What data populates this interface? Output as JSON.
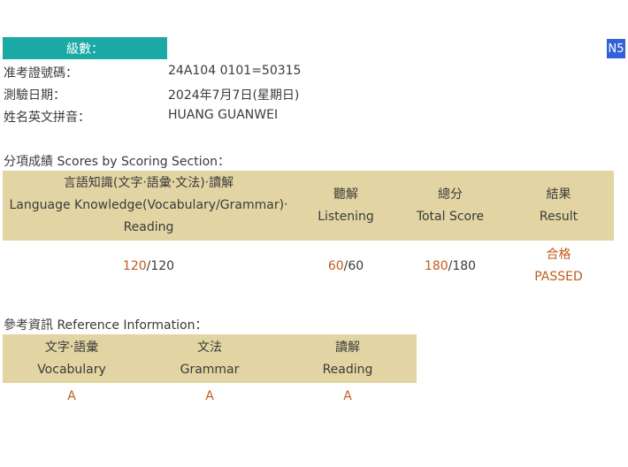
{
  "level": {
    "label": "級數：",
    "value": "N5"
  },
  "info": [
    {
      "label": "准考證號碼：",
      "value": "24A104 0101=50315"
    },
    {
      "label": "測驗日期：",
      "value": "2024年7月7日(星期日)"
    },
    {
      "label": "姓名英文拼音：",
      "value": "HUANG GUANWEI"
    }
  ],
  "scores": {
    "title": "分項成績 Scores by Scoring Section：",
    "headers": [
      {
        "zh": "言語知識(文字‧語彙‧文法)‧讀解",
        "en1": "Language Knowledge(Vocabulary/Grammar)‧",
        "en2": "Reading"
      },
      {
        "zh": "聽解",
        "en1": "Listening"
      },
      {
        "zh": "總分",
        "en1": "Total Score"
      },
      {
        "zh": "結果",
        "en1": "Result"
      }
    ],
    "row": {
      "lk_score": "120",
      "lk_max": "/120",
      "listening_score": "60",
      "listening_max": "/60",
      "total_score": "180",
      "total_max": "/180",
      "result_zh": "合格",
      "result_en": "PASSED"
    }
  },
  "reference": {
    "title": "參考資訊 Reference Information：",
    "headers": [
      {
        "zh": "文字‧語彙",
        "en": "Vocabulary"
      },
      {
        "zh": "文法",
        "en": "Grammar"
      },
      {
        "zh": "讀解",
        "en": "Reading"
      }
    ],
    "grades": [
      "A",
      "A",
      "A"
    ]
  },
  "colors": {
    "teal": "#1aa9a5",
    "badge_blue": "#3361d8",
    "table_header": "#e3d5a3",
    "highlight": "#c25a1c"
  }
}
